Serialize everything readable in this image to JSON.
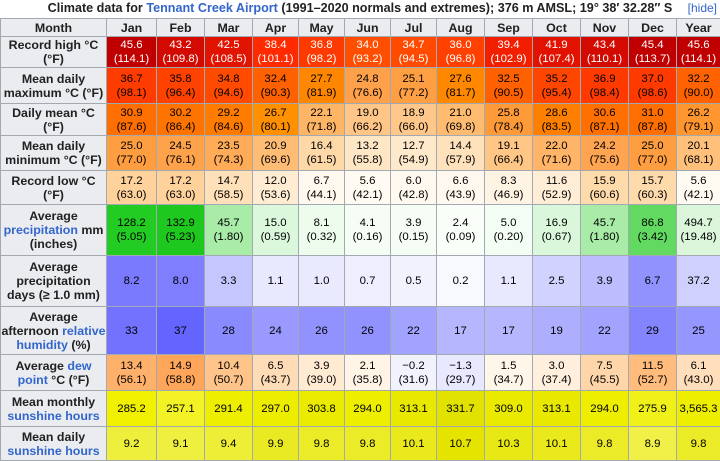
{
  "caption": {
    "prefix": "Climate data for ",
    "link": "Tennant Creek Airport",
    "suffix": " (1991–2020 normals and extremes); 376 m AMSL; 19° 38′ 32.28″ S"
  },
  "hide_label": "[hide]",
  "header": {
    "month_label": "Month",
    "months": [
      "Jan",
      "Feb",
      "Mar",
      "Apr",
      "May",
      "Jun",
      "Jul",
      "Aug",
      "Sep",
      "Oct",
      "Nov",
      "Dec"
    ],
    "year_label": "Year"
  },
  "rows": [
    {
      "height": 31,
      "label": [
        {
          "t": "Record high °C (°F)"
        }
      ],
      "cells": [
        {
          "v": "45.6",
          "s": "(114.1)",
          "bg": "#c00000",
          "fg": "#ffffff"
        },
        {
          "v": "43.2",
          "s": "(109.8)",
          "bg": "#d20a00",
          "fg": "#ffffff"
        },
        {
          "v": "42.5",
          "s": "(108.5)",
          "bg": "#e01400",
          "fg": "#ffffff"
        },
        {
          "v": "38.4",
          "s": "(101.1)",
          "bg": "#ff2a00",
          "fg": "#ffffff"
        },
        {
          "v": "36.8",
          "s": "(98.2)",
          "bg": "#ff3a00",
          "fg": "#ffffff"
        },
        {
          "v": "34.0",
          "s": "(93.2)",
          "bg": "#ff4e00",
          "fg": "#ffffff"
        },
        {
          "v": "34.7",
          "s": "(94.5)",
          "bg": "#ff4a00",
          "fg": "#ffffff"
        },
        {
          "v": "36.0",
          "s": "(96.8)",
          "bg": "#ff4000",
          "fg": "#ffffff"
        },
        {
          "v": "39.4",
          "s": "(102.9)",
          "bg": "#f21e00",
          "fg": "#ffffff"
        },
        {
          "v": "41.9",
          "s": "(107.4)",
          "bg": "#e21200",
          "fg": "#ffffff"
        },
        {
          "v": "43.4",
          "s": "(110.1)",
          "bg": "#d20a00",
          "fg": "#ffffff"
        },
        {
          "v": "45.4",
          "s": "(113.7)",
          "bg": "#c00000",
          "fg": "#ffffff"
        },
        {
          "v": "45.6",
          "s": "(114.1)",
          "bg": "#c00000",
          "fg": "#ffffff"
        }
      ]
    },
    {
      "height": 36,
      "label": [
        {
          "t": "Mean daily maximum °C (°F)"
        }
      ],
      "cells": [
        {
          "v": "36.7",
          "s": "(98.1)",
          "bg": "#ff3c00",
          "fg": "#000000"
        },
        {
          "v": "35.8",
          "s": "(96.4)",
          "bg": "#ff4200",
          "fg": "#000000"
        },
        {
          "v": "34.8",
          "s": "(94.6)",
          "bg": "#ff4a00",
          "fg": "#000000"
        },
        {
          "v": "32.4",
          "s": "(90.3)",
          "bg": "#ff6000",
          "fg": "#000000"
        },
        {
          "v": "27.7",
          "s": "(81.9)",
          "bg": "#ff8600",
          "fg": "#000000"
        },
        {
          "v": "24.8",
          "s": "(76.6)",
          "bg": "#ffa14a",
          "fg": "#000000"
        },
        {
          "v": "25.1",
          "s": "(77.2)",
          "bg": "#ff9f44",
          "fg": "#000000"
        },
        {
          "v": "27.6",
          "s": "(81.7)",
          "bg": "#ff8800",
          "fg": "#000000"
        },
        {
          "v": "32.5",
          "s": "(90.5)",
          "bg": "#ff6000",
          "fg": "#000000"
        },
        {
          "v": "35.2",
          "s": "(95.4)",
          "bg": "#ff4600",
          "fg": "#000000"
        },
        {
          "v": "36.9",
          "s": "(98.4)",
          "bg": "#ff3a00",
          "fg": "#000000"
        },
        {
          "v": "37.0",
          "s": "(98.6)",
          "bg": "#ff3a00",
          "fg": "#000000"
        },
        {
          "v": "32.2",
          "s": "(90.0)",
          "bg": "#ff6200",
          "fg": "#000000"
        }
      ]
    },
    {
      "height": 32,
      "label": [
        {
          "t": "Daily mean °C (°F)"
        }
      ],
      "cells": [
        {
          "v": "30.9",
          "s": "(87.6)",
          "bg": "#ff6e00",
          "fg": "#000000"
        },
        {
          "v": "30.2",
          "s": "(86.4)",
          "bg": "#ff7400",
          "fg": "#000000"
        },
        {
          "v": "29.2",
          "s": "(84.6)",
          "bg": "#ff7c00",
          "fg": "#000000"
        },
        {
          "v": "26.7",
          "s": "(80.1)",
          "bg": "#ff9000",
          "fg": "#000000"
        },
        {
          "v": "22.1",
          "s": "(71.8)",
          "bg": "#ffb566",
          "fg": "#000000"
        },
        {
          "v": "19.0",
          "s": "(66.2)",
          "bg": "#ffc688",
          "fg": "#000000"
        },
        {
          "v": "18.9",
          "s": "(66.0)",
          "bg": "#ffc78a",
          "fg": "#000000"
        },
        {
          "v": "21.0",
          "s": "(69.8)",
          "bg": "#ffbb70",
          "fg": "#000000"
        },
        {
          "v": "25.8",
          "s": "(78.4)",
          "bg": "#ff9a38",
          "fg": "#000000"
        },
        {
          "v": "28.6",
          "s": "(83.5)",
          "bg": "#ff8000",
          "fg": "#000000"
        },
        {
          "v": "30.6",
          "s": "(87.1)",
          "bg": "#ff7000",
          "fg": "#000000"
        },
        {
          "v": "31.0",
          "s": "(87.8)",
          "bg": "#ff6e00",
          "fg": "#000000"
        },
        {
          "v": "26.2",
          "s": "(79.1)",
          "bg": "#ff9630",
          "fg": "#000000"
        }
      ]
    },
    {
      "height": 35,
      "label": [
        {
          "t": "Mean daily minimum °C (°F)"
        }
      ],
      "cells": [
        {
          "v": "25.0",
          "s": "(77.0)",
          "bg": "#ff9e40",
          "fg": "#000000"
        },
        {
          "v": "24.5",
          "s": "(76.1)",
          "bg": "#ffa24c",
          "fg": "#000000"
        },
        {
          "v": "23.5",
          "s": "(74.3)",
          "bg": "#ffab58",
          "fg": "#000000"
        },
        {
          "v": "20.9",
          "s": "(69.6)",
          "bg": "#ffbc74",
          "fg": "#000000"
        },
        {
          "v": "16.4",
          "s": "(61.5)",
          "bg": "#ffd8a8",
          "fg": "#000000"
        },
        {
          "v": "13.2",
          "s": "(55.8)",
          "bg": "#ffe7c6",
          "fg": "#000000"
        },
        {
          "v": "12.7",
          "s": "(54.9)",
          "bg": "#ffe9cb",
          "fg": "#000000"
        },
        {
          "v": "14.4",
          "s": "(57.9)",
          "bg": "#ffe2bc",
          "fg": "#000000"
        },
        {
          "v": "19.1",
          "s": "(66.4)",
          "bg": "#ffc686",
          "fg": "#000000"
        },
        {
          "v": "22.0",
          "s": "(71.6)",
          "bg": "#ffb468",
          "fg": "#000000"
        },
        {
          "v": "24.2",
          "s": "(75.6)",
          "bg": "#ffa450",
          "fg": "#000000"
        },
        {
          "v": "25.0",
          "s": "(77.0)",
          "bg": "#ff9e40",
          "fg": "#000000"
        },
        {
          "v": "20.1",
          "s": "(68.1)",
          "bg": "#ffc07c",
          "fg": "#000000"
        }
      ]
    },
    {
      "height": 34,
      "label": [
        {
          "t": "Record low °C (°F)"
        }
      ],
      "cells": [
        {
          "v": "17.2",
          "s": "(63.0)",
          "bg": "#ffd29c",
          "fg": "#000000"
        },
        {
          "v": "17.2",
          "s": "(63.0)",
          "bg": "#ffd29c",
          "fg": "#000000"
        },
        {
          "v": "14.7",
          "s": "(58.5)",
          "bg": "#ffe0b8",
          "fg": "#000000"
        },
        {
          "v": "12.0",
          "s": "(53.6)",
          "bg": "#ffecd2",
          "fg": "#000000"
        },
        {
          "v": "6.7",
          "s": "(44.1)",
          "bg": "#fff8ee",
          "fg": "#000000"
        },
        {
          "v": "5.6",
          "s": "(42.1)",
          "bg": "#fffaf2",
          "fg": "#000000"
        },
        {
          "v": "6.0",
          "s": "(42.8)",
          "bg": "#fff9f0",
          "fg": "#000000"
        },
        {
          "v": "6.6",
          "s": "(43.9)",
          "bg": "#fff8ee",
          "fg": "#000000"
        },
        {
          "v": "8.3",
          "s": "(46.9)",
          "bg": "#fff4e4",
          "fg": "#000000"
        },
        {
          "v": "11.6",
          "s": "(52.9)",
          "bg": "#ffedd6",
          "fg": "#000000"
        },
        {
          "v": "15.9",
          "s": "(60.6)",
          "bg": "#ffdaaa",
          "fg": "#000000"
        },
        {
          "v": "15.7",
          "s": "(60.3)",
          "bg": "#ffdbac",
          "fg": "#000000"
        },
        {
          "v": "5.6",
          "s": "(42.1)",
          "bg": "#fffaf2",
          "fg": "#000000"
        }
      ]
    },
    {
      "height": 51,
      "label": [
        {
          "t": "Average "
        },
        {
          "t": "precipitation",
          "link": true
        },
        {
          "t": " mm (inches)"
        }
      ],
      "cells": [
        {
          "v": "128.2",
          "s": "(5.05)",
          "bg": "#22cc22",
          "fg": "#000000"
        },
        {
          "v": "132.9",
          "s": "(5.23)",
          "bg": "#1ec81e",
          "fg": "#000000"
        },
        {
          "v": "45.7",
          "s": "(1.80)",
          "bg": "#a8eca8",
          "fg": "#000000"
        },
        {
          "v": "15.0",
          "s": "(0.59)",
          "bg": "#dcf8dc",
          "fg": "#000000"
        },
        {
          "v": "8.1",
          "s": "(0.32)",
          "bg": "#eefcee",
          "fg": "#000000"
        },
        {
          "v": "4.1",
          "s": "(0.16)",
          "bg": "#f5fdf5",
          "fg": "#000000"
        },
        {
          "v": "3.9",
          "s": "(0.15)",
          "bg": "#f5fdf5",
          "fg": "#000000"
        },
        {
          "v": "2.4",
          "s": "(0.09)",
          "bg": "#f9fef9",
          "fg": "#000000"
        },
        {
          "v": "5.0",
          "s": "(0.20)",
          "bg": "#f3fdf3",
          "fg": "#000000"
        },
        {
          "v": "16.9",
          "s": "(0.67)",
          "bg": "#dbf7db",
          "fg": "#000000"
        },
        {
          "v": "45.7",
          "s": "(1.80)",
          "bg": "#a8eca8",
          "fg": "#000000"
        },
        {
          "v": "86.8",
          "s": "(3.42)",
          "bg": "#62da62",
          "fg": "#000000"
        },
        {
          "v": "494.7",
          "s": "(19.48)",
          "bg": "#dcf6dc",
          "fg": "#000000"
        }
      ]
    },
    {
      "height": 51,
      "label": [
        {
          "t": "Average precipitation days (≥ 1.0 mm)",
          "small": " (≥ 1.0 mm)"
        }
      ],
      "cells": [
        {
          "v": "8.2",
          "s": "",
          "bg": "#7a7aff",
          "fg": "#000000"
        },
        {
          "v": "8.0",
          "s": "",
          "bg": "#7e7eff",
          "fg": "#000000"
        },
        {
          "v": "3.3",
          "s": "",
          "bg": "#c6c6ff",
          "fg": "#000000"
        },
        {
          "v": "1.1",
          "s": "",
          "bg": "#e8e8ff",
          "fg": "#000000"
        },
        {
          "v": "1.0",
          "s": "",
          "bg": "#eaeaff",
          "fg": "#000000"
        },
        {
          "v": "0.7",
          "s": "",
          "bg": "#eeeeff",
          "fg": "#000000"
        },
        {
          "v": "0.5",
          "s": "",
          "bg": "#f2f2ff",
          "fg": "#000000"
        },
        {
          "v": "0.2",
          "s": "",
          "bg": "#f8f8ff",
          "fg": "#000000"
        },
        {
          "v": "1.1",
          "s": "",
          "bg": "#e8e8ff",
          "fg": "#000000"
        },
        {
          "v": "2.5",
          "s": "",
          "bg": "#d2d2ff",
          "fg": "#000000"
        },
        {
          "v": "3.9",
          "s": "",
          "bg": "#bcbcff",
          "fg": "#000000"
        },
        {
          "v": "6.7",
          "s": "",
          "bg": "#9292ff",
          "fg": "#000000"
        },
        {
          "v": "37.2",
          "s": "",
          "bg": "#d0d0ff",
          "fg": "#000000"
        }
      ]
    },
    {
      "height": 48,
      "label": [
        {
          "t": "Average afternoon "
        },
        {
          "t": "relative humidity",
          "link": true
        },
        {
          "t": " (%)"
        }
      ],
      "cells": [
        {
          "v": "33",
          "s": "",
          "bg": "#7272ff",
          "fg": "#000000"
        },
        {
          "v": "37",
          "s": "",
          "bg": "#6464ff",
          "fg": "#000000"
        },
        {
          "v": "28",
          "s": "",
          "bg": "#8a8aff",
          "fg": "#000000"
        },
        {
          "v": "24",
          "s": "",
          "bg": "#9999ff",
          "fg": "#000000"
        },
        {
          "v": "26",
          "s": "",
          "bg": "#9292ff",
          "fg": "#000000"
        },
        {
          "v": "26",
          "s": "",
          "bg": "#9292ff",
          "fg": "#000000"
        },
        {
          "v": "22",
          "s": "",
          "bg": "#a2a2ff",
          "fg": "#000000"
        },
        {
          "v": "17",
          "s": "",
          "bg": "#b6b6ff",
          "fg": "#000000"
        },
        {
          "v": "17",
          "s": "",
          "bg": "#b6b6ff",
          "fg": "#000000"
        },
        {
          "v": "19",
          "s": "",
          "bg": "#aeaeff",
          "fg": "#000000"
        },
        {
          "v": "22",
          "s": "",
          "bg": "#a2a2ff",
          "fg": "#000000"
        },
        {
          "v": "29",
          "s": "",
          "bg": "#8484ff",
          "fg": "#000000"
        },
        {
          "v": "25",
          "s": "",
          "bg": "#9696ff",
          "fg": "#000000"
        }
      ]
    },
    {
      "height": 36,
      "label": [
        {
          "t": "Average "
        },
        {
          "t": "dew point",
          "link": true
        },
        {
          "t": " °C (°F)"
        }
      ],
      "cells": [
        {
          "v": "13.4",
          "s": "(56.1)",
          "bg": "#ffb06a",
          "fg": "#000000"
        },
        {
          "v": "14.9",
          "s": "(58.8)",
          "bg": "#ffa65a",
          "fg": "#000000"
        },
        {
          "v": "10.4",
          "s": "(50.7)",
          "bg": "#ffc48a",
          "fg": "#000000"
        },
        {
          "v": "6.5",
          "s": "(43.7)",
          "bg": "#ffdcb8",
          "fg": "#000000"
        },
        {
          "v": "3.9",
          "s": "(39.0)",
          "bg": "#ffead2",
          "fg": "#000000"
        },
        {
          "v": "2.1",
          "s": "(35.8)",
          "bg": "#fff4e6",
          "fg": "#000000"
        },
        {
          "v": "−0.2",
          "s": "(31.6)",
          "bg": "#f2f2ff",
          "fg": "#000000"
        },
        {
          "v": "−1.3",
          "s": "(29.7)",
          "bg": "#e8e8ff",
          "fg": "#000000"
        },
        {
          "v": "1.5",
          "s": "(34.7)",
          "bg": "#fff6ea",
          "fg": "#000000"
        },
        {
          "v": "3.0",
          "s": "(37.4)",
          "bg": "#ffefdc",
          "fg": "#000000"
        },
        {
          "v": "7.5",
          "s": "(45.5)",
          "bg": "#ffd6aa",
          "fg": "#000000"
        },
        {
          "v": "11.5",
          "s": "(52.7)",
          "bg": "#ffbc7c",
          "fg": "#000000"
        },
        {
          "v": "6.1",
          "s": "(43.0)",
          "bg": "#ffdebc",
          "fg": "#000000"
        }
      ]
    },
    {
      "height": 36,
      "label": [
        {
          "t": "Mean monthly "
        },
        {
          "t": "sunshine hours",
          "link": true
        }
      ],
      "cells": [
        {
          "v": "285.2",
          "s": "",
          "bg": "#f0f000",
          "fg": "#000000"
        },
        {
          "v": "257.1",
          "s": "",
          "bg": "#f2f224",
          "fg": "#000000"
        },
        {
          "v": "291.4",
          "s": "",
          "bg": "#eeee00",
          "fg": "#000000"
        },
        {
          "v": "297.0",
          "s": "",
          "bg": "#eded00",
          "fg": "#000000"
        },
        {
          "v": "303.8",
          "s": "",
          "bg": "#ebeb00",
          "fg": "#000000"
        },
        {
          "v": "294.0",
          "s": "",
          "bg": "#eeee00",
          "fg": "#000000"
        },
        {
          "v": "313.1",
          "s": "",
          "bg": "#e8e800",
          "fg": "#000000"
        },
        {
          "v": "331.7",
          "s": "",
          "bg": "#e2e200",
          "fg": "#000000"
        },
        {
          "v": "309.0",
          "s": "",
          "bg": "#eaea00",
          "fg": "#000000"
        },
        {
          "v": "313.1",
          "s": "",
          "bg": "#e8e800",
          "fg": "#000000"
        },
        {
          "v": "294.0",
          "s": "",
          "bg": "#eeee00",
          "fg": "#000000"
        },
        {
          "v": "275.9",
          "s": "",
          "bg": "#f1f11a",
          "fg": "#000000"
        },
        {
          "v": "3,565.3",
          "s": "",
          "bg": "#eeee00",
          "fg": "#000000"
        }
      ]
    },
    {
      "height": 34,
      "label": [
        {
          "t": "Mean daily "
        },
        {
          "t": "sunshine hours",
          "link": true
        }
      ],
      "cells": [
        {
          "v": "9.2",
          "s": "",
          "bg": "#eeee3c",
          "fg": "#000000"
        },
        {
          "v": "9.1",
          "s": "",
          "bg": "#efef40",
          "fg": "#000000"
        },
        {
          "v": "9.4",
          "s": "",
          "bg": "#eeee36",
          "fg": "#000000"
        },
        {
          "v": "9.9",
          "s": "",
          "bg": "#eaea24",
          "fg": "#000000"
        },
        {
          "v": "9.8",
          "s": "",
          "bg": "#ebeb28",
          "fg": "#000000"
        },
        {
          "v": "9.8",
          "s": "",
          "bg": "#ebeb28",
          "fg": "#000000"
        },
        {
          "v": "10.1",
          "s": "",
          "bg": "#e9e91c",
          "fg": "#000000"
        },
        {
          "v": "10.7",
          "s": "",
          "bg": "#e4e400",
          "fg": "#000000"
        },
        {
          "v": "10.3",
          "s": "",
          "bg": "#e8e814",
          "fg": "#000000"
        },
        {
          "v": "10.1",
          "s": "",
          "bg": "#e9e91c",
          "fg": "#000000"
        },
        {
          "v": "9.8",
          "s": "",
          "bg": "#ebeb28",
          "fg": "#000000"
        },
        {
          "v": "8.9",
          "s": "",
          "bg": "#f0f048",
          "fg": "#000000"
        },
        {
          "v": "9.8",
          "s": "",
          "bg": "#ebeb28",
          "fg": "#000000"
        }
      ]
    }
  ]
}
